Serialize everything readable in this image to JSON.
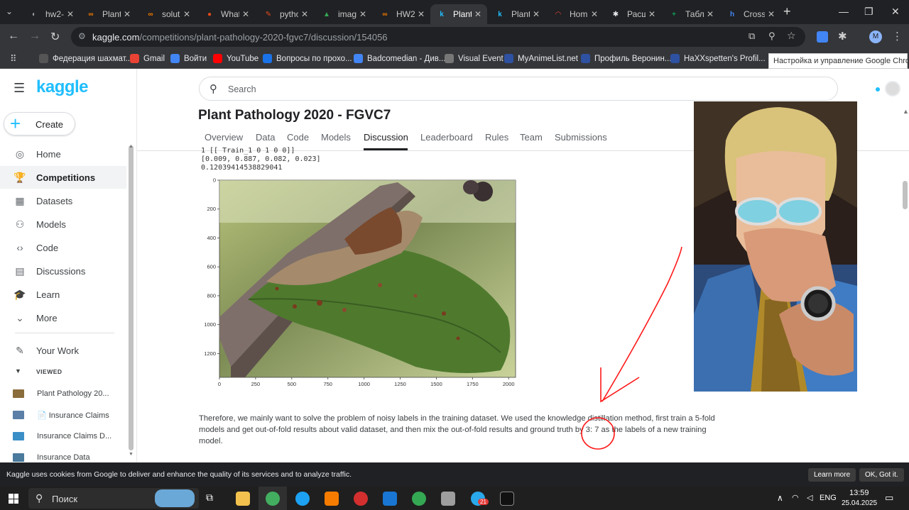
{
  "tabs": [
    {
      "label": "hw2-",
      "color": "#9aa0a6",
      "glyph": "◐",
      "active": false
    },
    {
      "label": "Plant",
      "color": "#f57c00",
      "glyph": "∞",
      "active": false
    },
    {
      "label": "solut",
      "color": "#f57c00",
      "glyph": "∞",
      "active": false
    },
    {
      "label": "What",
      "color": "#e64a19",
      "glyph": "●",
      "active": false
    },
    {
      "label": "pytho",
      "color": "#e64a19",
      "glyph": "✎",
      "active": false
    },
    {
      "label": "imag",
      "color": "#34a853",
      "glyph": "▲",
      "active": false
    },
    {
      "label": "HW2",
      "color": "#f57c00",
      "glyph": "∞",
      "active": false
    },
    {
      "label": "Plant",
      "color": "#20beff",
      "glyph": "k",
      "active": true
    },
    {
      "label": "Plant",
      "color": "#20beff",
      "glyph": "k",
      "active": false
    },
    {
      "label": "Hom",
      "color": "#ea4335",
      "glyph": "◠",
      "active": false
    },
    {
      "label": "Расш",
      "color": "#e8eaed",
      "glyph": "✱",
      "active": false
    },
    {
      "label": "Табл",
      "color": "#0f9d58",
      "glyph": "+",
      "active": false
    },
    {
      "label": "Cross",
      "color": "#4285f4",
      "glyph": "h",
      "active": false
    }
  ],
  "new_tab_glyph": "+",
  "window_controls": {
    "minimize": "—",
    "maximize": "❐",
    "close": "✕"
  },
  "address": {
    "host": "kaggle.com",
    "path": "/competitions/plant-pathology-2020-fgvc7/discussion/154056"
  },
  "profile_initial": "M",
  "bookmarks": [
    {
      "label": "Федерация шахмат...",
      "color": "#555"
    },
    {
      "label": "Gmail",
      "color": "#ea4335"
    },
    {
      "label": "Войти",
      "color": "#4285f4"
    },
    {
      "label": "YouTube",
      "color": "#ff0000"
    },
    {
      "label": "Вопросы по прохо...",
      "color": "#1a73e8"
    },
    {
      "label": "Badcomedian - Див...",
      "color": "#4285f4"
    },
    {
      "label": "Visual Event",
      "color": "#777"
    },
    {
      "label": "MyAnimeList.net",
      "color": "#2e51a2"
    },
    {
      "label": "Профиль Веронин...",
      "color": "#2e51a2"
    },
    {
      "label": "HaXXspetten's Profil...",
      "color": "#2e51a2"
    }
  ],
  "tooltip": "Настройка и управление Google Chrome",
  "brand": {
    "logo": "kaggle",
    "color": "#20beff"
  },
  "create_label": "Create",
  "nav": [
    {
      "label": "Home",
      "icon": "◎",
      "selected": false
    },
    {
      "label": "Competitions",
      "icon": "🏆",
      "selected": true
    },
    {
      "label": "Datasets",
      "icon": "▦",
      "selected": false
    },
    {
      "label": "Models",
      "icon": "⚇",
      "selected": false
    },
    {
      "label": "Code",
      "icon": "‹›",
      "selected": false
    },
    {
      "label": "Discussions",
      "icon": "▤",
      "selected": false
    },
    {
      "label": "Learn",
      "icon": "🎓",
      "selected": false
    },
    {
      "label": "More",
      "icon": "⌄",
      "selected": false
    }
  ],
  "your_work": "Your Work",
  "viewed_label": "VIEWED",
  "viewed": [
    {
      "label": "Plant Pathology 20...",
      "color": "#8a6d3b"
    },
    {
      "label": "📄 Insurance Claims",
      "color": "#5b7fa6"
    },
    {
      "label": "Insurance Claims D...",
      "color": "#3b8fc7"
    },
    {
      "label": "Insurance Data",
      "color": "#4a7a9c"
    }
  ],
  "search_placeholder": "Search",
  "competition_title": "Plant Pathology 2020 - FGVC7",
  "page_tabs": [
    "Overview",
    "Data",
    "Code",
    "Models",
    "Discussion",
    "Leaderboard",
    "Rules",
    "Team",
    "Submissions"
  ],
  "active_page_tab": "Discussion",
  "code_lines": [
    "1 [[ Train_1  0 1 0 0]]",
    "[0.009, 0.887, 0.082, 0.023]",
    "0.12039414538829041"
  ],
  "chart_data": {
    "type": "image",
    "x_ticks": [
      "0",
      "250",
      "500",
      "750",
      "1000",
      "1250",
      "1500",
      "1750",
      "2000"
    ],
    "y_ticks": [
      "0",
      "200",
      "400",
      "600",
      "800",
      "1000",
      "1200"
    ],
    "xlim": [
      0,
      2048
    ],
    "ylim": [
      1365,
      0
    ]
  },
  "paragraph": "Therefore, we mainly want to solve the problem of noisy labels in the training dataset. We used the knowledge distillation method, first train a 5-fold models and get out-of-fold results about valid dataset, and then mix the out-of-fold results and ground truth by 3: 7 as the labels of a new training model.",
  "cookie": {
    "text": "Kaggle uses cookies from Google to deliver and enhance the quality of its services and to analyze traffic.",
    "learn_more": "Learn more",
    "ok": "OK, Got it."
  },
  "taskbar": {
    "search_label": "Поиск",
    "lang": "ENG",
    "time": "13:59",
    "date": "25.04.2025",
    "badge": "21"
  },
  "annotation_color": "#ff1a1a"
}
